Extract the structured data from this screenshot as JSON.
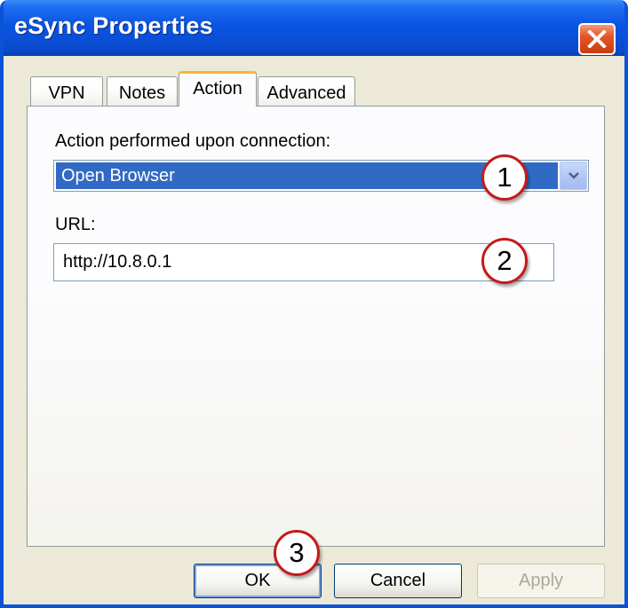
{
  "window": {
    "title": "eSync Properties"
  },
  "tabs": [
    {
      "label": "VPN"
    },
    {
      "label": "Notes"
    },
    {
      "label": "Action",
      "active": true
    },
    {
      "label": "Advanced"
    }
  ],
  "action": {
    "label": "Action performed upon connection:",
    "selected": "Open Browser"
  },
  "url": {
    "label": "URL:",
    "value": "http://10.8.0.1"
  },
  "callouts": [
    "1",
    "2",
    "3"
  ],
  "buttons": {
    "ok": "OK",
    "cancel": "Cancel",
    "apply": "Apply"
  },
  "colors": {
    "titlebar": "#0a54e2",
    "selection": "#316ac5",
    "callout_border": "#c61a1a",
    "active_tab_accent": "#f8b53c"
  },
  "icons": {
    "close": "close-icon",
    "dropdown": "chevron-down-icon"
  }
}
